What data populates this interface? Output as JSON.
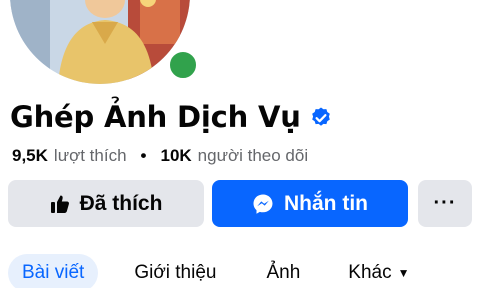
{
  "profile": {
    "name": "Ghép Ảnh Dịch Vụ",
    "verified": true,
    "online": true,
    "likes_count": "9,5K",
    "likes_label": "lượt thích",
    "followers_count": "10K",
    "followers_label": "người theo dõi",
    "separator": "•"
  },
  "actions": {
    "like_label": "Đã thích",
    "message_label": "Nhắn tin",
    "more_label": "···"
  },
  "tabs": [
    {
      "label": "Bài viết",
      "active": true
    },
    {
      "label": "Giới thiệu",
      "active": false
    },
    {
      "label": "Ảnh",
      "active": false
    },
    {
      "label": "Khác",
      "active": false
    }
  ],
  "colors": {
    "accent": "#0866ff",
    "online": "#31a24c",
    "button_gray": "#e4e6eb",
    "secondary_text": "#65676b"
  },
  "icons": {
    "verified": "verified-badge-icon",
    "like": "thumbs-up-icon",
    "message": "messenger-icon",
    "more": "more-dots-icon",
    "dropdown": "caret-down-icon"
  }
}
